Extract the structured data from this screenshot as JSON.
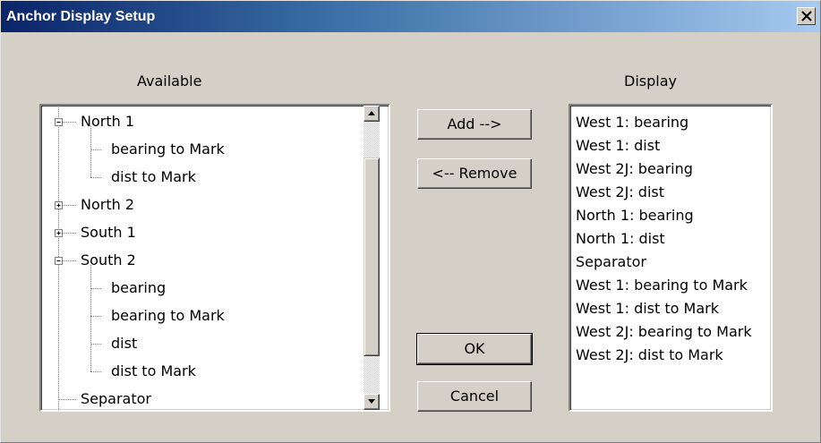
{
  "window": {
    "title": "Anchor Display Setup"
  },
  "available": {
    "heading": "Available",
    "tree": [
      {
        "label": "North 1",
        "level": 0,
        "expander": "minus"
      },
      {
        "label": "bearing to Mark",
        "level": 1
      },
      {
        "label": "dist to Mark",
        "level": 1
      },
      {
        "label": "North 2",
        "level": 0,
        "expander": "plus"
      },
      {
        "label": "South 1",
        "level": 0,
        "expander": "plus"
      },
      {
        "label": "South 2",
        "level": 0,
        "expander": "minus"
      },
      {
        "label": "bearing",
        "level": 1
      },
      {
        "label": "bearing to Mark",
        "level": 1
      },
      {
        "label": "dist",
        "level": 1
      },
      {
        "label": "dist to Mark",
        "level": 1
      },
      {
        "label": "Separator",
        "level": 0
      }
    ]
  },
  "display": {
    "heading": "Display",
    "items": [
      "West 1: bearing",
      "West 1: dist",
      "West 2J: bearing",
      "West 2J: dist",
      "North 1: bearing",
      "North 1: dist",
      "Separator",
      "West 1: bearing to Mark",
      "West 1: dist to Mark",
      "West 2J: bearing to Mark",
      "West 2J: dist to Mark"
    ]
  },
  "buttons": {
    "add": "Add -->",
    "remove": "<-- Remove",
    "ok": "OK",
    "cancel": "Cancel"
  },
  "icons": {
    "close": "close-icon",
    "scroll_up": "scroll-up-arrow-icon",
    "scroll_down": "scroll-down-arrow-icon",
    "collapse": "tree-collapse-icon",
    "expand": "tree-expand-icon"
  },
  "colors": {
    "title_bar_start": "#0a246a",
    "title_bar_end": "#a6caf0",
    "dialog_face": "#d4d0c8"
  }
}
